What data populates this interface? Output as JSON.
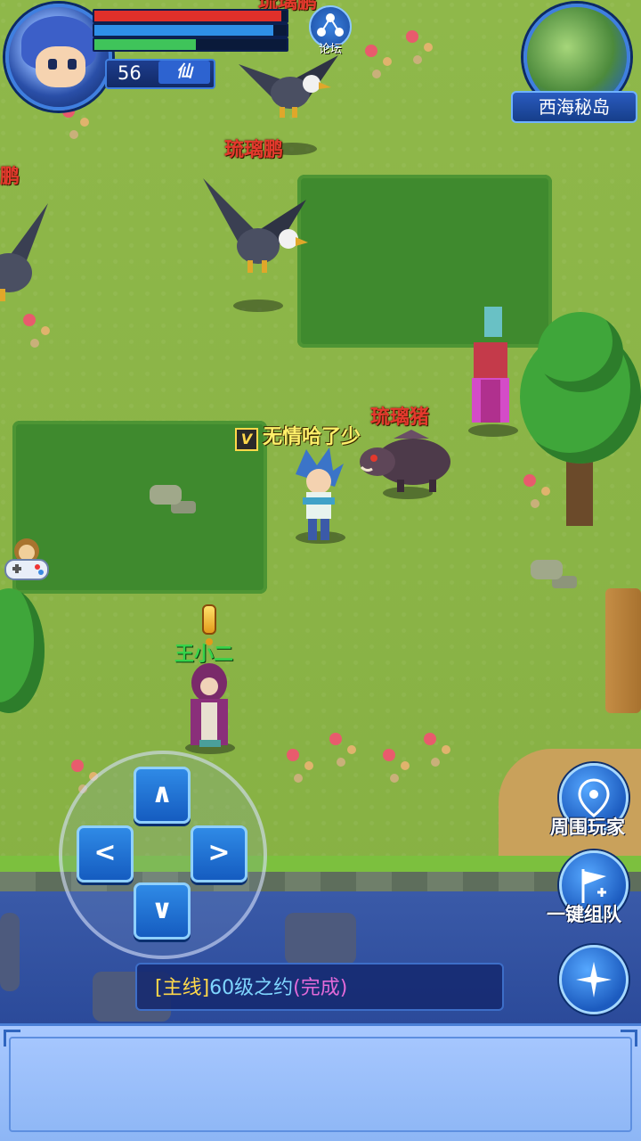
{
  "hud": {
    "level": "56",
    "class_title": "仙",
    "hp_ratio": 0.97,
    "mp_ratio": 0.93,
    "xp_ratio": 0.53,
    "forum_label": "论坛"
  },
  "minimap": {
    "location_name": "西海秘岛"
  },
  "entities": {
    "eagle_top_name": "琉璃鹏",
    "eagle_left_name": "璃鹏",
    "boar_name": "琉璃猪",
    "player_name": "无情哈了少",
    "player_vip_badge": "V",
    "npc_name": "王小二",
    "top_partial_name": "琉璃鹏"
  },
  "right_buttons": {
    "nearby_players": "周围玩家",
    "one_click_team": "一键组队"
  },
  "quest": {
    "tag": "[主线]",
    "name": "60级之约",
    "status": "(完成)"
  },
  "colors": {
    "hp": "#e0302a",
    "mp": "#2e8fe8",
    "xp": "#3fc45a",
    "accent": "#3f7fe0"
  },
  "icons": [
    "map-pin-icon",
    "flag-plus-icon",
    "compass-star-icon",
    "forum-node-icon",
    "gamepad-monkey-icon"
  ]
}
